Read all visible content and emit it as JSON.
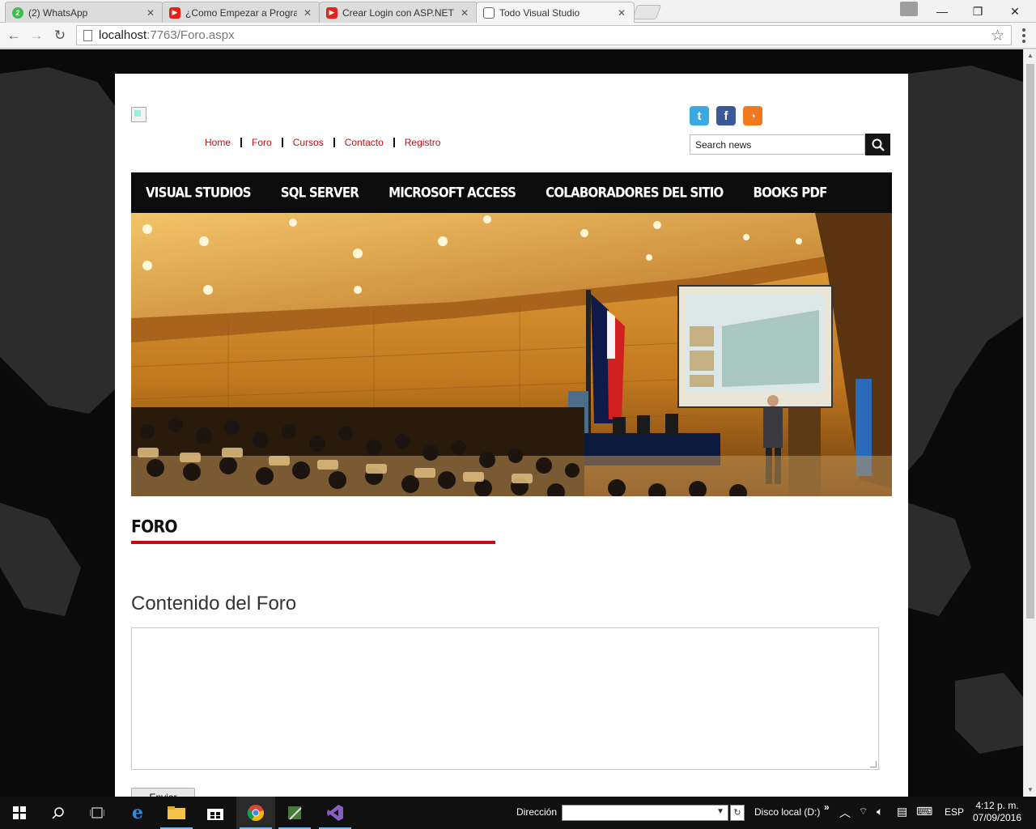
{
  "browser": {
    "tabs": [
      {
        "title": "(2) WhatsApp",
        "favicon": "whatsapp-icon",
        "favicon_color": "#3dbd4e",
        "badge": "2"
      },
      {
        "title": "¿Como Empezar a Program",
        "favicon": "youtube-icon",
        "favicon_color": "#e62117"
      },
      {
        "title": "Crear Login con ASP.NET",
        "favicon": "youtube-icon",
        "favicon_color": "#e62117"
      },
      {
        "title": "Todo Visual Studio",
        "favicon": "page-icon",
        "favicon_color": "#ffffff"
      }
    ],
    "url_host": "localhost",
    "url_port_path": ":7763/Foro.aspx"
  },
  "site": {
    "top_links": [
      "Home",
      "Foro",
      "Cursos",
      "Contacto",
      "Registro"
    ],
    "search_placeholder": "Search news",
    "main_nav": [
      "Visual Studios",
      "SQL Server",
      "Microsoft Access",
      "Colaboradores del sitio",
      "Books PDF"
    ],
    "section_title": "FORO",
    "content_heading": "Contenido del Foro",
    "submit_label": "Enviar",
    "accent_color": "#c30a0f"
  },
  "taskbar": {
    "address_label": "Dirección",
    "drive_label": "Disco local (D:)",
    "language": "ESP",
    "time": "4:12 p. m.",
    "date": "07/09/2016"
  }
}
